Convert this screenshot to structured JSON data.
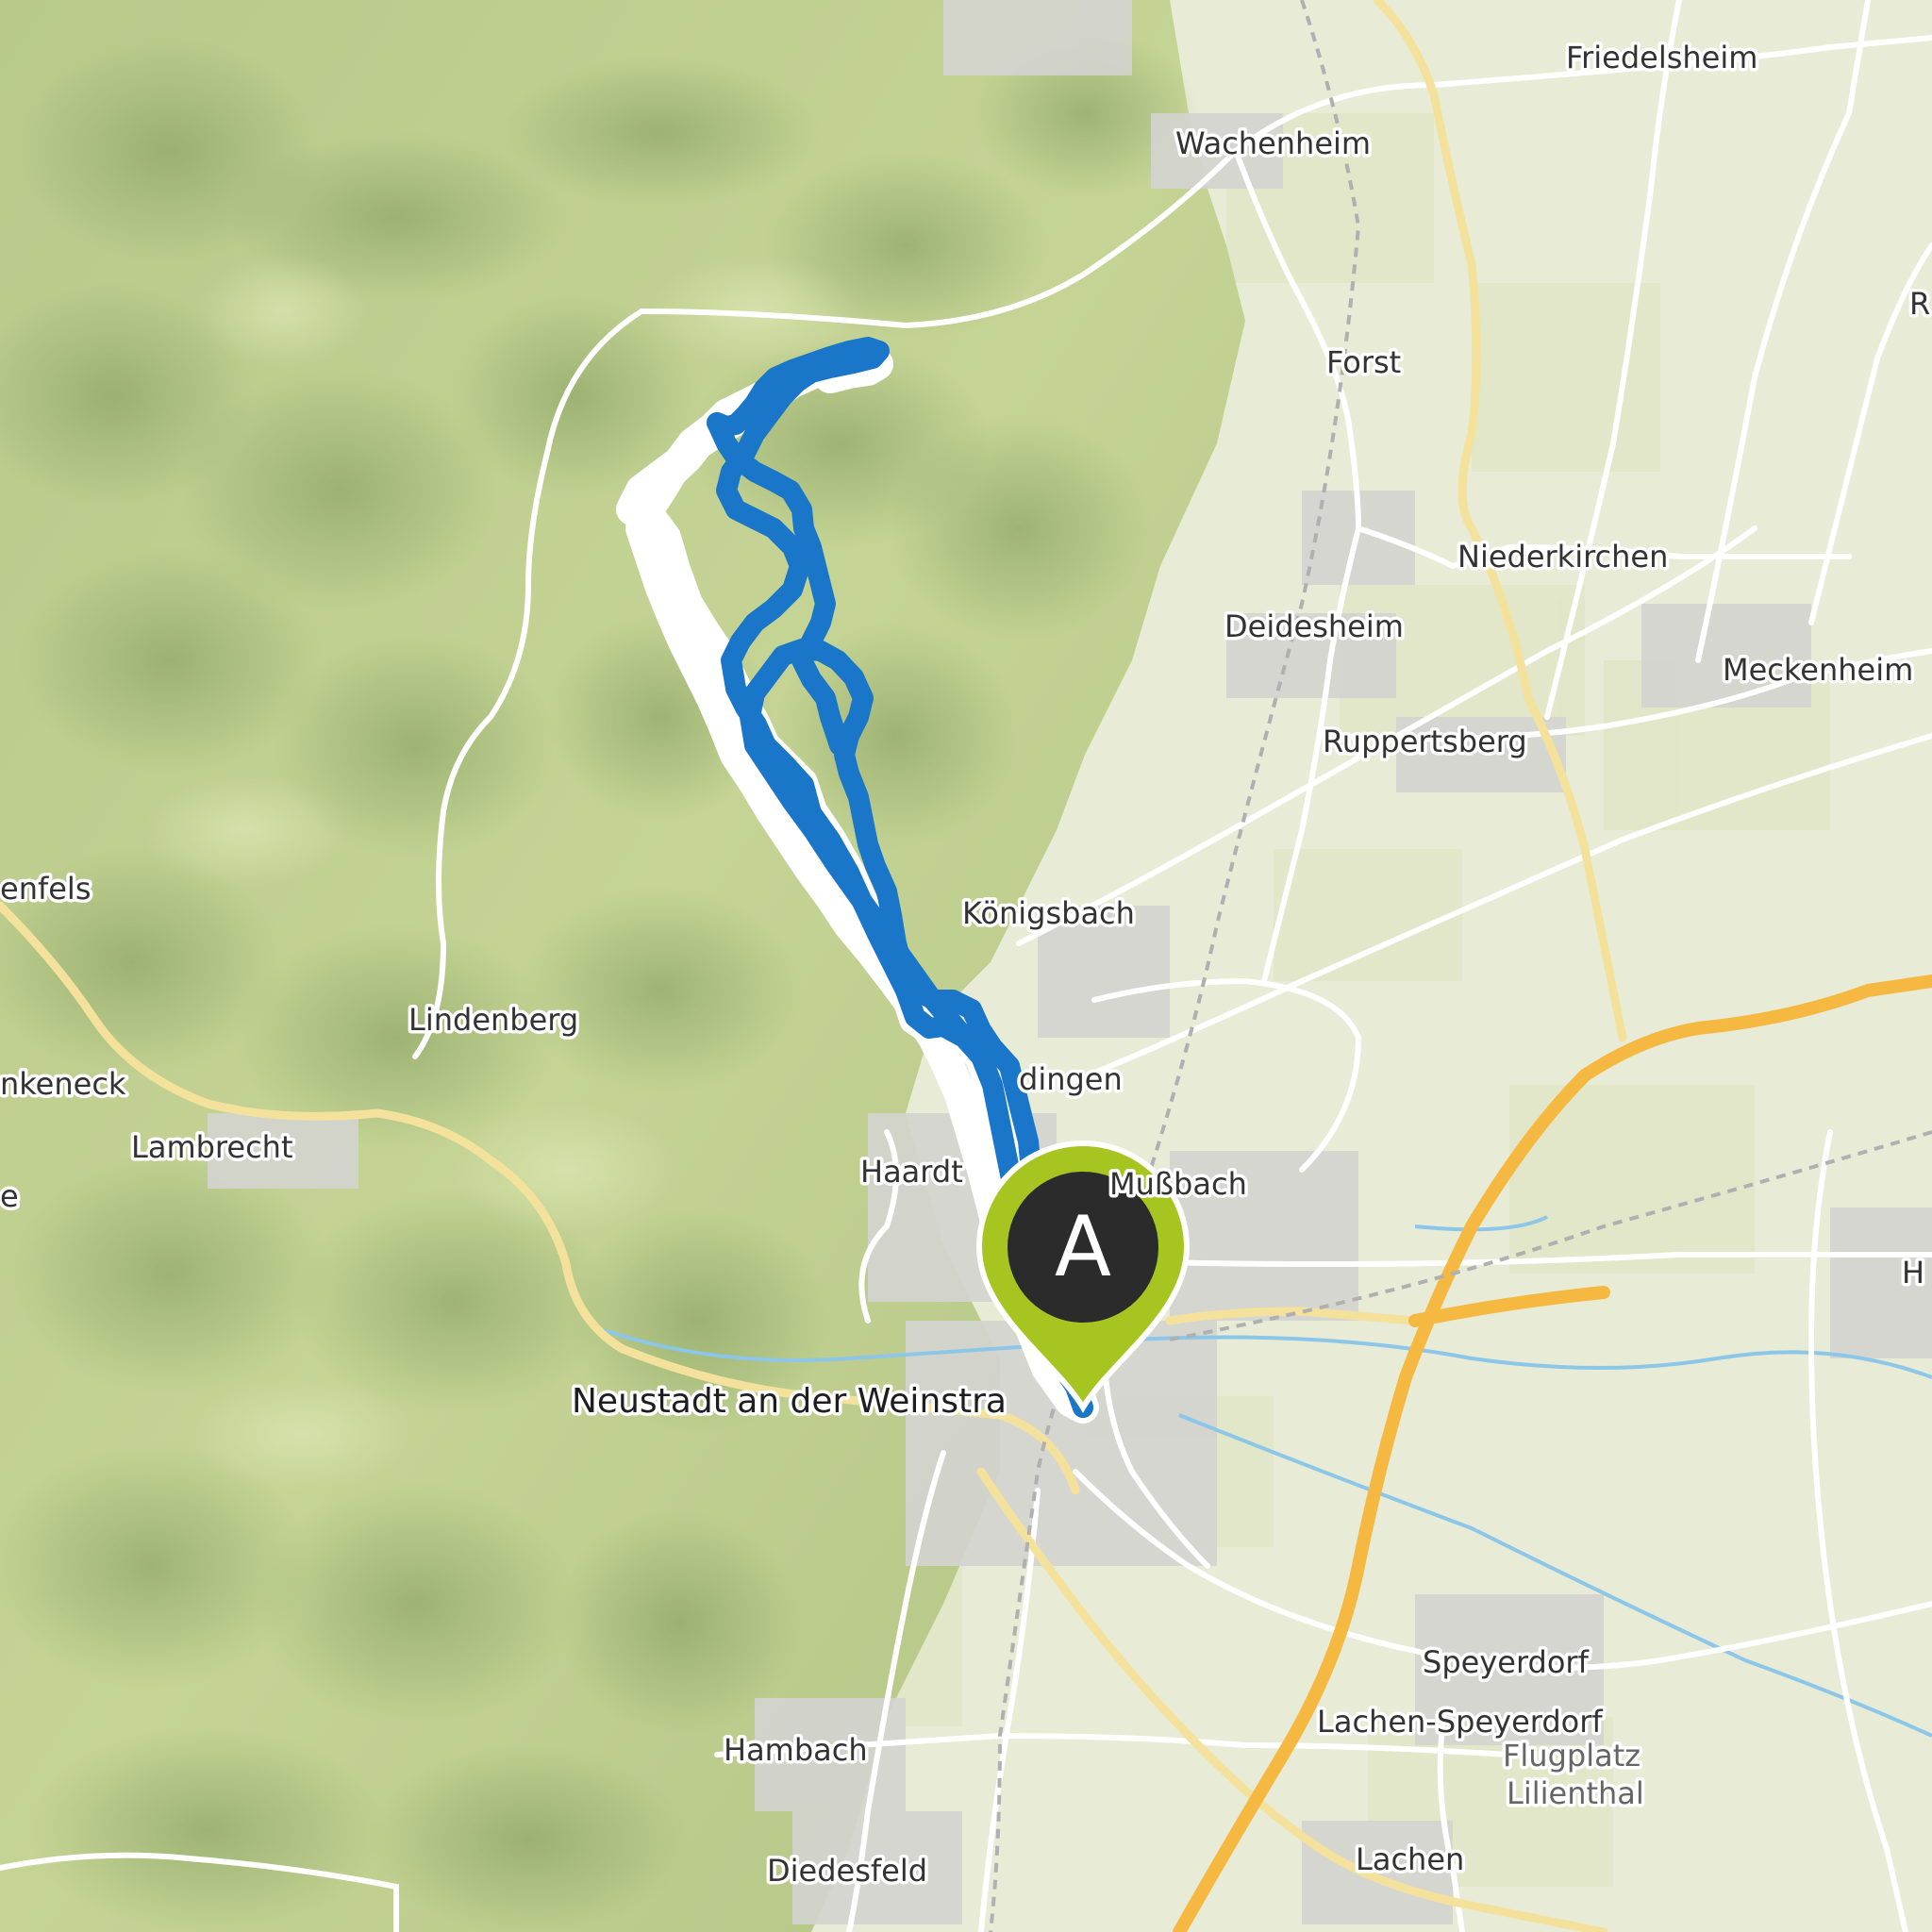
{
  "map": {
    "towns": [
      {
        "id": "friedelsheim",
        "name": "Friedelsheim",
        "style": "normal"
      },
      {
        "id": "wachenheim",
        "name": "Wachenheim",
        "style": "normal"
      },
      {
        "id": "forst",
        "name": "Forst",
        "style": "normal"
      },
      {
        "id": "niederkirchen",
        "name": "Niederkirchen",
        "style": "normal"
      },
      {
        "id": "deidesheim",
        "name": "Deidesheim",
        "style": "normal"
      },
      {
        "id": "meckenheim",
        "name": "Meckenheim",
        "style": "normal"
      },
      {
        "id": "ruppertsberg",
        "name": "Ruppertsberg",
        "style": "normal"
      },
      {
        "id": "koenigsbach",
        "name": "Königsbach",
        "style": "normal"
      },
      {
        "id": "lindenberg",
        "name": "Lindenberg",
        "style": "normal"
      },
      {
        "id": "gimmeldingen",
        "name": "dingen",
        "style": "normal"
      },
      {
        "id": "lambrecht",
        "name": "Lambrecht",
        "style": "normal"
      },
      {
        "id": "haardt",
        "name": "Haardt",
        "style": "normal"
      },
      {
        "id": "mussbach",
        "name": "Mußbach",
        "style": "normal"
      },
      {
        "id": "neustadt",
        "name": "Neustadt an der Weinstra",
        "style": "big"
      },
      {
        "id": "speyerdorf",
        "name": "Speyerdorf",
        "style": "normal"
      },
      {
        "id": "lachen-speyerdorf",
        "name": "Lachen-Speyerdorf",
        "style": "normal"
      },
      {
        "id": "flugplatz",
        "name": "Flugplatz",
        "style": "grey"
      },
      {
        "id": "lilienthal",
        "name": "Lilienthal",
        "style": "grey"
      },
      {
        "id": "hambach",
        "name": "Hambach",
        "style": "normal"
      },
      {
        "id": "diedesfeld",
        "name": "Diedesfeld",
        "style": "normal"
      },
      {
        "id": "lachen",
        "name": "Lachen",
        "style": "normal"
      },
      {
        "id": "frankeneck",
        "name": "nkeneck",
        "style": "normal"
      },
      {
        "id": "weidenthal",
        "name": "enfels",
        "style": "normal"
      },
      {
        "id": "partial-e",
        "name": "e",
        "style": "normal"
      },
      {
        "id": "partial-r",
        "name": "R",
        "style": "normal"
      },
      {
        "id": "partial-h",
        "name": "H",
        "style": "normal"
      }
    ],
    "start_marker": {
      "letter": "A",
      "fill": "#2b2b2b",
      "ring": "#a6c520"
    },
    "colors": {
      "route": "#1a76c9",
      "route_outline": "#ffffff",
      "forest_light": "#c9d79a",
      "forest_dark": "#8da766",
      "lowland": "#e9ecd8",
      "settlement": "#d2d2d2",
      "road_primary": "#f5c542",
      "road_secondary": "#f7e7a1",
      "road_minor": "#ffffff",
      "water": "#8cc6e8"
    }
  }
}
